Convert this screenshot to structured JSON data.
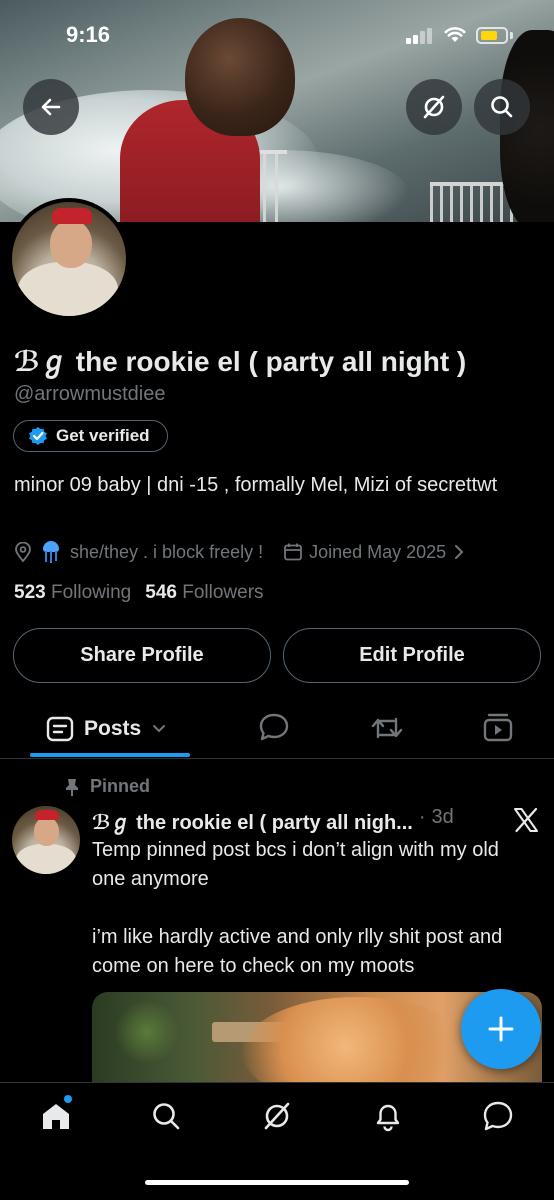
{
  "status_bar": {
    "time": "9:16"
  },
  "profile": {
    "display_name": "ℬℊ the rookie el ( party all night )",
    "handle": "@arrowmustdiee",
    "get_verified_label": "Get verified",
    "bio": "minor 09 baby | dni -15 , formally Mel, Mizi of secrettwt",
    "location_text": "she/they . i block freely !",
    "joined_text": "Joined May 2025",
    "following_count": "523",
    "following_label": "Following",
    "followers_count": "546",
    "followers_label": "Followers"
  },
  "actions": {
    "share_label": "Share Profile",
    "edit_label": "Edit Profile"
  },
  "tabs": {
    "posts_label": "Posts"
  },
  "pinned_post": {
    "pinned_label": "Pinned",
    "author": "ℬℊ the rookie el ( party all nigh...",
    "separator": "·",
    "time": "3d",
    "text_1": "Temp pinned post bcs i don’t align with my old one anymore",
    "text_2": "i’m like hardly active and only rlly shit post and come on here to check on my moots"
  },
  "colors": {
    "accent": "#1d9bf0",
    "background": "#000000",
    "muted": "#71767b"
  }
}
